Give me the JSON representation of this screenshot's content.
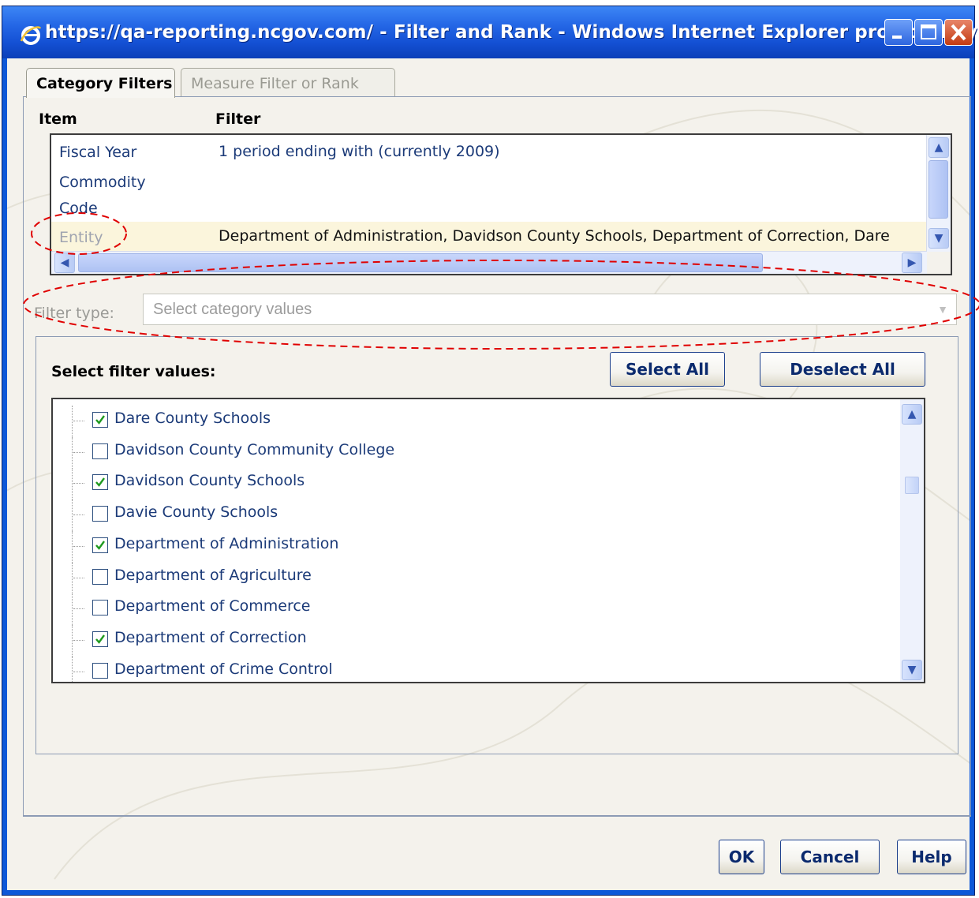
{
  "window": {
    "title": "https://qa-reporting.ncgov.com/ - Filter and Rank - Windows Internet Explorer provided by ...",
    "icon": "ie-icon",
    "controls": [
      "minimize-icon",
      "maximize-icon",
      "close-icon"
    ]
  },
  "tabs": [
    {
      "label": "Category Filters",
      "active": true
    },
    {
      "label": "Measure Filter or Rank",
      "active": false
    }
  ],
  "grid": {
    "headers": {
      "item": "Item",
      "filter": "Filter"
    },
    "rows": [
      {
        "item": "Fiscal Year",
        "filter": "1 period ending with  (currently 2009)"
      },
      {
        "item": "Commodity",
        "item2": "Code",
        "filter": ""
      },
      {
        "item": "Entity",
        "filter": "Department of Administration, Davidson County Schools, Department of Correction, Dare",
        "selected": true
      }
    ]
  },
  "filter_type": {
    "label": "Filter type:",
    "value": "Select category values",
    "disabled": true
  },
  "values": {
    "label": "Select filter values:",
    "select_all": "Select All",
    "deselect_all": "Deselect All",
    "items": [
      {
        "label": "Dare County Schools",
        "checked": true
      },
      {
        "label": "Davidson County Community College",
        "checked": false
      },
      {
        "label": "Davidson County Schools",
        "checked": true
      },
      {
        "label": "Davie County Schools",
        "checked": false
      },
      {
        "label": "Department of Administration",
        "checked": true
      },
      {
        "label": "Department of Agriculture",
        "checked": false
      },
      {
        "label": "Department of Commerce",
        "checked": false
      },
      {
        "label": "Department of Correction",
        "checked": true
      },
      {
        "label": "Department of Crime Control",
        "checked": false
      }
    ]
  },
  "footer": {
    "ok": "OK",
    "cancel": "Cancel",
    "help": "Help"
  },
  "colors": {
    "titlebar": "#2568e6",
    "link_text": "#1b3a78",
    "annotation": "#e00000",
    "selected_row": "#fbf5dc"
  }
}
